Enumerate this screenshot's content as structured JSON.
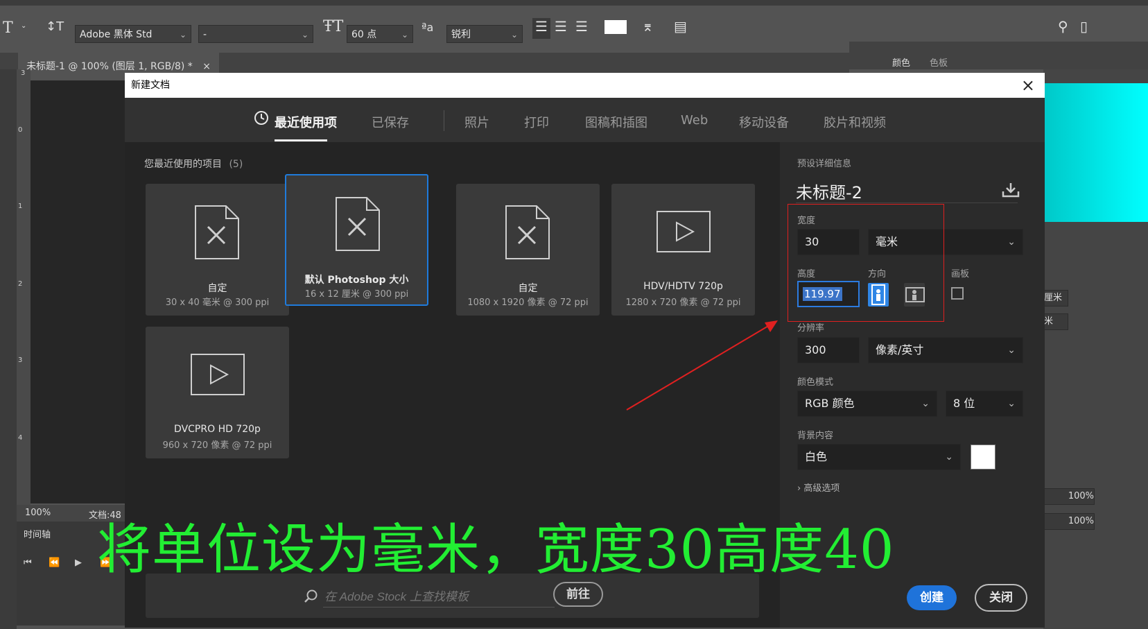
{
  "app": {
    "doc_tab_title": "未标题-1 @ 100% (图层 1, RGB/8) *",
    "doc_tab_close": "×",
    "status_zoom": "100%",
    "status_doc": "文档:48",
    "timeline_label": "时间轴",
    "ruler_marks": [
      "3",
      "0",
      "1",
      "2",
      "3",
      "4"
    ]
  },
  "options_bar": {
    "tool_glyph": "T",
    "font_family": "Adobe 黑体 Std",
    "font_style": "-",
    "font_size": "60 点",
    "aa_method": "锐利"
  },
  "right_panels": {
    "tab_color": "颜色",
    "tab_swatches": "色板",
    "unit_mm_1": "厘米",
    "unit_mm_2": "米",
    "opacity_1": "100%",
    "opacity_2": "100%"
  },
  "dialog": {
    "title": "新建文档",
    "close_glyph": "×",
    "tabs": [
      {
        "label": "最近使用项",
        "active": true
      },
      {
        "label": "已保存",
        "active": false
      },
      {
        "label": "照片",
        "active": false
      },
      {
        "label": "打印",
        "active": false
      },
      {
        "label": "图稿和插图",
        "active": false
      },
      {
        "label": "Web",
        "active": false
      },
      {
        "label": "移动设备",
        "active": false
      },
      {
        "label": "胶片和视频",
        "active": false
      }
    ],
    "recent_header": "您最近使用的项目",
    "recent_count": "(5)",
    "recent_items": [
      {
        "name": "自定",
        "spec": "30 x 40 毫米 @ 300 ppi",
        "icon": "document-icon"
      },
      {
        "name": "默认 Photoshop 大小",
        "spec": "16 x 12 厘米 @ 300 ppi",
        "icon": "document-icon",
        "selected": true
      },
      {
        "name": "自定",
        "spec": "1080 x 1920 像素 @ 72 ppi",
        "icon": "document-icon"
      },
      {
        "name": "HDV/HDTV 720p",
        "spec": "1280 x 720 像素 @ 72 ppi",
        "icon": "video-icon"
      },
      {
        "name": "DVCPRO HD 720p",
        "spec": "960 x 720 像素 @ 72 ppi",
        "icon": "video-icon"
      }
    ],
    "search": {
      "placeholder": "在 Adobe Stock 上查找模板",
      "go_label": "前往"
    },
    "preset": {
      "section_title": "预设详细信息",
      "name": "未标题-2",
      "width_label": "宽度",
      "width_value": "30",
      "width_unit": "毫米",
      "height_label": "高度",
      "height_value": "119.97",
      "orientation_label": "方向",
      "artboard_label": "画板",
      "resolution_label": "分辨率",
      "resolution_value": "300",
      "resolution_unit": "像素/英寸",
      "color_mode_label": "颜色模式",
      "color_mode_value": "RGB 颜色",
      "bit_depth_value": "8 位",
      "background_label": "背景内容",
      "background_value": "白色",
      "advanced_label": "高级选项",
      "create_label": "创建",
      "close_label": "关闭"
    }
  },
  "annotation": {
    "caption": "将单位设为毫米，宽度30高度40",
    "caption_color": "#22ee33",
    "highlight_color": "#e02020"
  },
  "colors": {
    "accent": "#1f73da",
    "selection_border": "#1f7bdc"
  }
}
